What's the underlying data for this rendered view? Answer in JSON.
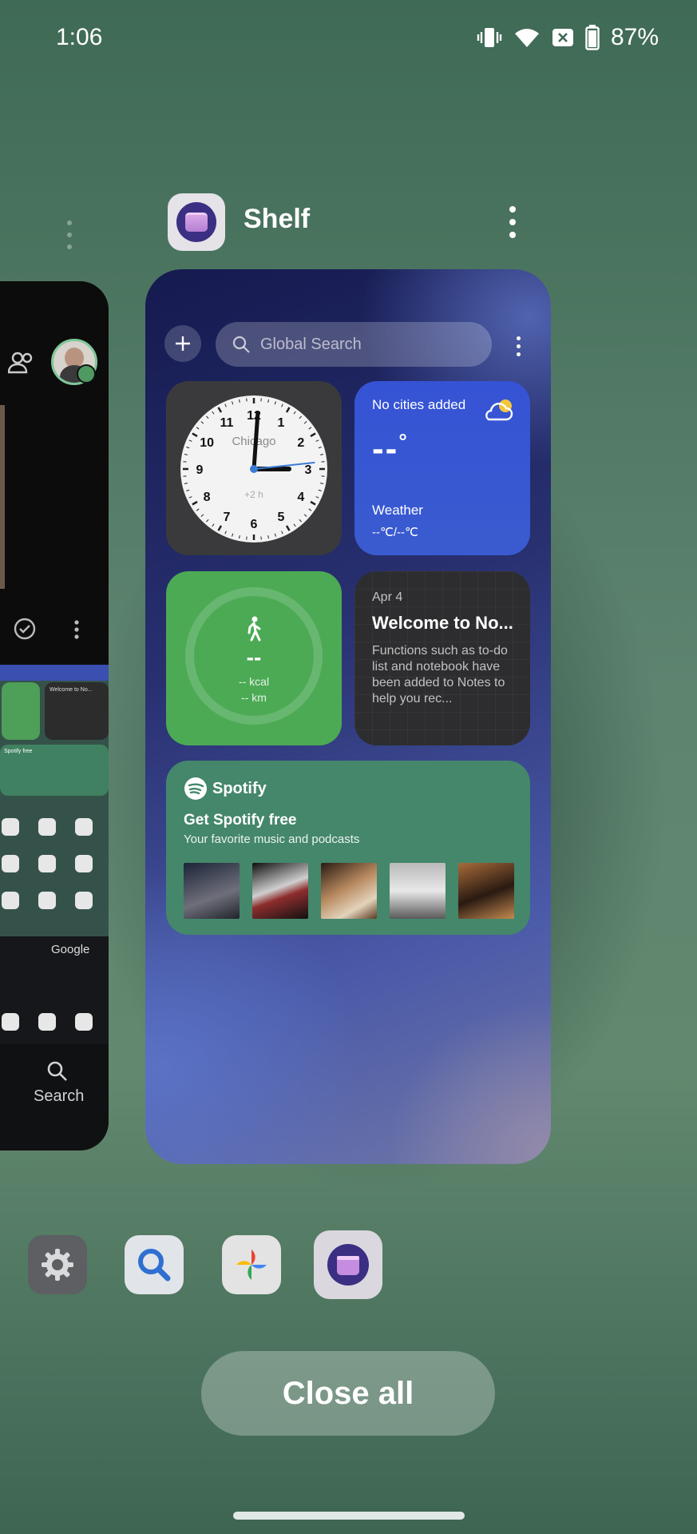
{
  "status_bar": {
    "time": "1:06",
    "battery": "87%",
    "icons": [
      "vibrate-icon",
      "wifi-icon",
      "no-sim-icon",
      "battery-icon"
    ]
  },
  "left_card": {
    "google_label": "Google",
    "search_label": "Search",
    "mini_notes_title": "Welcome to No...",
    "mini_spotify": "Spotify free"
  },
  "app": {
    "name": "Shelf",
    "icon": "shelf-app-icon"
  },
  "shelf": {
    "search_placeholder": "Global Search",
    "clock": {
      "city": "Chicago",
      "offset": "+2 h",
      "numbers": [
        "12",
        "1",
        "2",
        "3",
        "4",
        "5",
        "6",
        "7",
        "8",
        "9",
        "10",
        "11"
      ],
      "hour": 3,
      "minute": 0,
      "second": 14
    },
    "weather": {
      "message": "No cities added",
      "temp": "--",
      "degree": "°",
      "label": "Weather",
      "range": "--℃/--℃"
    },
    "steps": {
      "count": "--",
      "kcal": "-- kcal",
      "km": "-- km"
    },
    "notes": {
      "date": "Apr 4",
      "title": "Welcome to No...",
      "body": "Functions such as to-do list and notebook have been added to Notes to help you rec..."
    },
    "spotify": {
      "logo_text": "Spotify",
      "title": "Get Spotify free",
      "subtitle": "Your favorite music and podcasts",
      "albums": [
        "album-1",
        "album-2",
        "album-3",
        "album-4",
        "album-5"
      ]
    }
  },
  "dock": [
    "settings-app-icon",
    "magnifier-app-icon",
    "photos-app-icon",
    "shelf-app-icon"
  ],
  "close_all_label": "Close all",
  "colors": {
    "spotify_green": "#44876b",
    "weather_blue": "#3553d4",
    "steps_green": "#4caa55"
  }
}
